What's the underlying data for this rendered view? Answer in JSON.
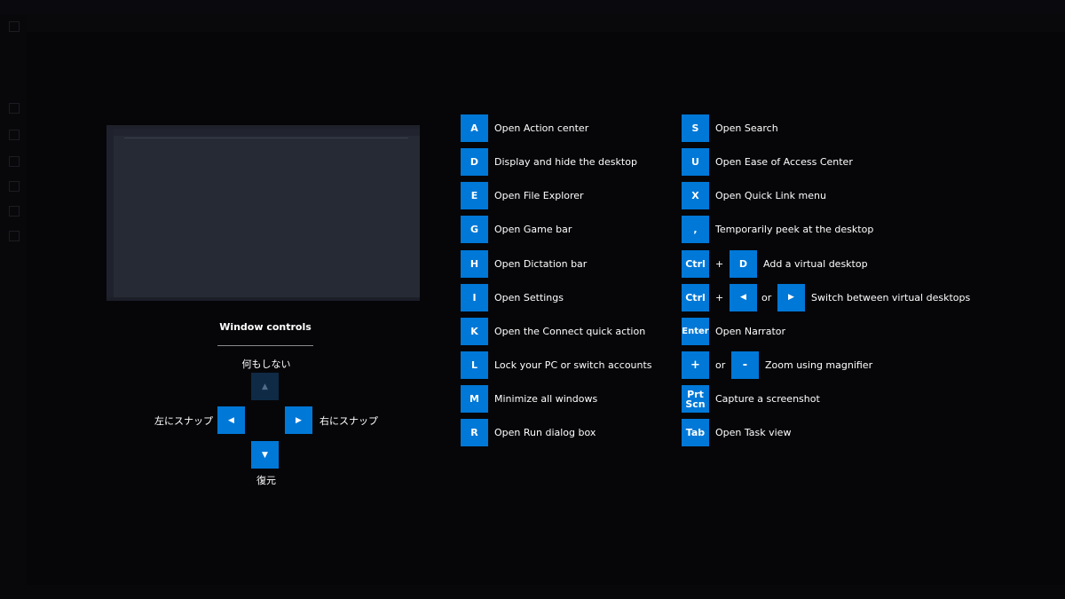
{
  "window_controls": {
    "title": "Window controls",
    "up_label": "何もしない",
    "left_label": "左にスナップ",
    "right_label": "右にスナップ",
    "down_label": "復元",
    "up_icon": "triangle-up-icon",
    "down_icon": "triangle-down-icon",
    "left_icon": "triangle-left-icon",
    "right_icon": "triangle-right-icon"
  },
  "shortcuts_left": [
    {
      "key": "A",
      "label": "Open Action center"
    },
    {
      "key": "D",
      "label": "Display and hide the desktop"
    },
    {
      "key": "E",
      "label": "Open File Explorer"
    },
    {
      "key": "G",
      "label": "Open Game bar"
    },
    {
      "key": "H",
      "label": "Open Dictation bar"
    },
    {
      "key": "I",
      "label": "Open Settings"
    },
    {
      "key": "K",
      "label": "Open the Connect quick action"
    },
    {
      "key": "L",
      "label": "Lock your PC or switch accounts"
    },
    {
      "key": "M",
      "label": "Minimize all windows"
    },
    {
      "key": "R",
      "label": "Open Run dialog box"
    }
  ],
  "shortcuts_right": [
    {
      "key": "S",
      "label": "Open Search"
    },
    {
      "key": "U",
      "label": "Open Ease of Access Center"
    },
    {
      "key": "X",
      "label": "Open Quick Link menu"
    },
    {
      "key": ",",
      "label": "Temporarily peek at the desktop"
    },
    {
      "keys": [
        "Ctrl",
        "D"
      ],
      "ops": [
        "+"
      ],
      "label": "Add a virtual desktop"
    },
    {
      "keys": [
        "Ctrl",
        "◀",
        "▶"
      ],
      "ops": [
        "+",
        "or"
      ],
      "label": "Switch between virtual desktops"
    },
    {
      "key": "Enter",
      "label": "Open Narrator"
    },
    {
      "keys": [
        "+",
        "-"
      ],
      "ops": [
        "or"
      ],
      "label": "Zoom using magnifier"
    },
    {
      "key_line1": "Prt",
      "key_line2": "Scn",
      "label": "Capture a screenshot"
    },
    {
      "key": "Tab",
      "label": "Open Task view"
    }
  ],
  "colors": {
    "accent": "#0078d7",
    "background": "#060609",
    "text": "#ffffff"
  }
}
